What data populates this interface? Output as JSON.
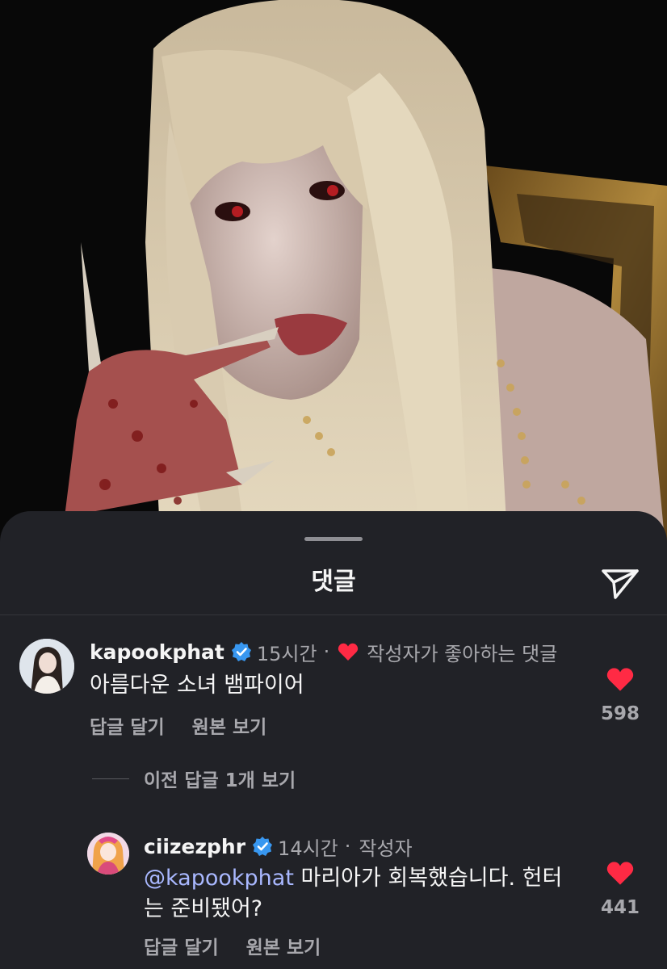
{
  "sheet": {
    "title": "댓글",
    "share_icon": "paper-plane-icon"
  },
  "comments": [
    {
      "username": "kapookphat",
      "verified": true,
      "time": "15시간",
      "separator": "·",
      "badge_text": "작성자가 좋아하는 댓글",
      "text": "아름다운 소녀 뱀파이어",
      "reply_label": "답글 달기",
      "view_original_label": "원본 보기",
      "like_count": "598",
      "liked": true
    }
  ],
  "view_previous_replies": "이전 답글 1개 보기",
  "reply": {
    "username": "ciizezphr",
    "verified": true,
    "time": "14시간",
    "separator": "·",
    "role": "작성자",
    "mention": "@kapookphat",
    "text_line1": " 마리아가 회복했습니다. 헌터",
    "text_line2": "는 준비됐어?",
    "reply_label": "답글 달기",
    "view_original_label": "원본 보기",
    "like_count": "441",
    "liked": true
  },
  "colors": {
    "sheet_bg": "#212227",
    "heart_red": "#ff2a44",
    "verified_blue": "#3897f0",
    "mention_blue": "#a9b8ff",
    "secondary_text": "#a8a8ad"
  }
}
